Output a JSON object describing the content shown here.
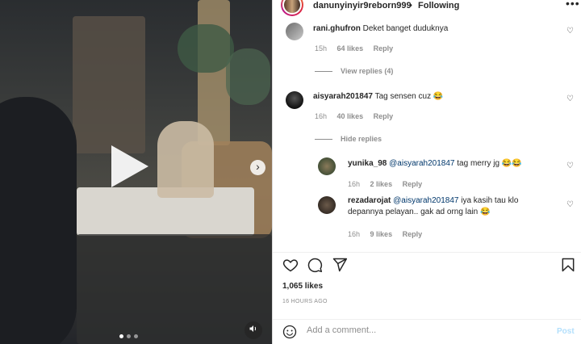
{
  "header": {
    "username": "danunyinyir9reborn999",
    "separator": "•",
    "follow_label": "Following",
    "more_icon": "more-horizontal-icon"
  },
  "comments": [
    {
      "username": "rani.ghufron",
      "text": "Deket banget duduknya",
      "time": "15h",
      "likes": "64 likes",
      "reply": "Reply",
      "replies_toggle": "View replies (4)"
    },
    {
      "username": "aisyarah201847",
      "text": "Tag sensen cuz 😂",
      "time": "16h",
      "likes": "40 likes",
      "reply": "Reply",
      "replies_toggle": "Hide replies",
      "replies": [
        {
          "username": "yunika_98",
          "mention": "@aisyarah201847",
          "text": "tag merry jg 😂😂",
          "time": "16h",
          "likes": "2 likes",
          "reply": "Reply"
        },
        {
          "username": "rezadarojat",
          "mention": "@aisyarah201847",
          "text": "iya kasih tau klo depannya pelayan.. gak ad orng lain 😂",
          "time": "16h",
          "likes": "9 likes",
          "reply": "Reply"
        }
      ]
    }
  ],
  "actions": {
    "like_icon": "heart-icon",
    "comment_icon": "comment-icon",
    "share_icon": "share-icon",
    "save_icon": "bookmark-icon"
  },
  "likes_count": "1,065 likes",
  "post_date": "16 HOURS AGO",
  "add_comment": {
    "placeholder": "Add a comment...",
    "post_label": "Post",
    "emoji_icon": "emoji-icon"
  },
  "media": {
    "play_icon": "play-icon",
    "next_icon": "chevron-right-icon",
    "mute_icon": "volume-icon",
    "slide_count": 3,
    "active_slide": 1
  },
  "colors": {
    "link": "#00376b",
    "muted": "#8e8e8e",
    "post_disabled": "#b2dffc"
  }
}
